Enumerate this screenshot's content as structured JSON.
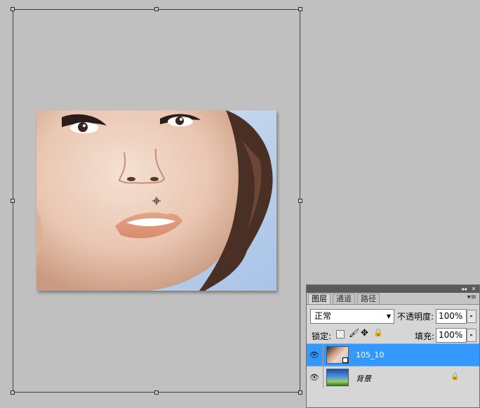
{
  "layers_panel": {
    "tabs": [
      "图层",
      "通道",
      "路径"
    ],
    "active_tab": 0,
    "blend_mode": "正常",
    "opacity_label": "不透明度:",
    "opacity_value": "100%",
    "lock_label": "锁定:",
    "fill_label": "填充:",
    "fill_value": "100%",
    "collapse_glyph": "◂◂",
    "close_glyph": "✕",
    "menu_glyph": "▾≡",
    "layers": [
      {
        "name": "105_10",
        "selected": true
      },
      {
        "name": "背景",
        "selected": false,
        "locked": true
      }
    ]
  },
  "colors": {
    "canvas_bg": "#c0c0c0",
    "selection_highlight": "#3399ff"
  },
  "icons": {
    "eye": "eye-icon",
    "lock": "lock-icon",
    "brush": "brush-icon",
    "move": "move-icon",
    "transparency": "transparency-lock-icon",
    "reference_point": "crosshair-icon"
  }
}
